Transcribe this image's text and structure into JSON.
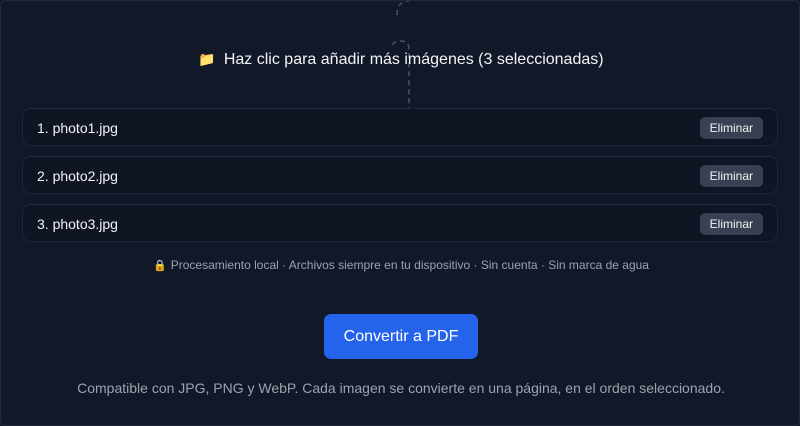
{
  "dropzone": {
    "icon": "folder-icon",
    "label": "Haz clic para añadir más imágenes (3 seleccionadas)"
  },
  "files": [
    {
      "name": "1. photo1.jpg",
      "remove_label": "Eliminar"
    },
    {
      "name": "2. photo2.jpg",
      "remove_label": "Eliminar"
    },
    {
      "name": "3. photo3.jpg",
      "remove_label": "Eliminar"
    }
  ],
  "privacy": {
    "icon": "lock-icon",
    "text": "Procesamiento local · Archivos siempre en tu dispositivo · Sin cuenta · Sin marca de agua"
  },
  "convert_button": {
    "label": "Convertir a PDF"
  },
  "footnote": "Compatible con JPG, PNG y WebP. Cada imagen se convierte en una página, en el orden seleccionado.",
  "colors": {
    "background": "#111827",
    "accent": "#2563eb",
    "button_secondary": "#374151",
    "muted_text": "#9ca3af"
  }
}
